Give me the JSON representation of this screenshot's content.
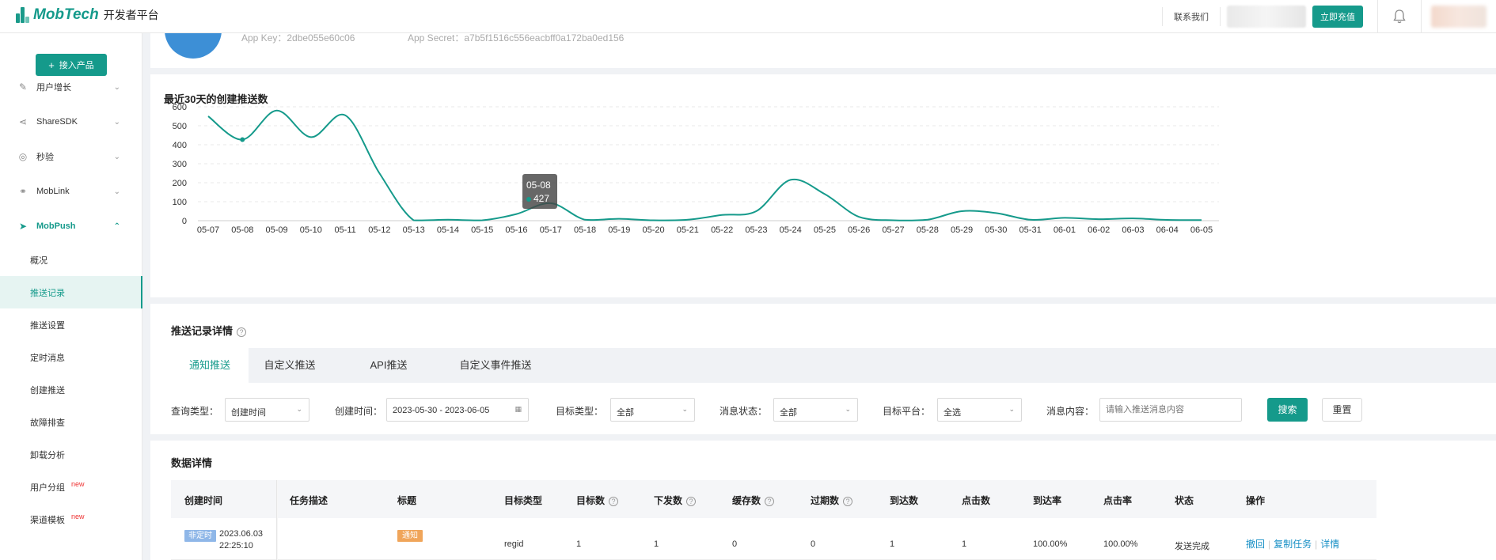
{
  "header": {
    "brand": "MobTech",
    "subtitle": "开发者平台",
    "contact": "联系我们",
    "recharge": "立即充值"
  },
  "sidebar": {
    "add_button": "接入产品",
    "groups": [
      {
        "label": "用户增长",
        "icon": "growth-icon"
      },
      {
        "label": "ShareSDK",
        "icon": "share-icon"
      },
      {
        "label": "秒验",
        "icon": "verify-icon"
      },
      {
        "label": "MobLink",
        "icon": "link-icon"
      },
      {
        "label": "MobPush",
        "icon": "send-icon"
      }
    ],
    "subitems": [
      {
        "label": "概况"
      },
      {
        "label": "推送记录",
        "active": true
      },
      {
        "label": "推送设置"
      },
      {
        "label": "定时消息"
      },
      {
        "label": "创建推送"
      },
      {
        "label": "故障排查"
      },
      {
        "label": "卸载分析"
      },
      {
        "label": "用户分组",
        "badge": "new"
      },
      {
        "label": "渠道模板",
        "badge": "new"
      }
    ]
  },
  "app_card": {
    "key_label": "App Key：2dbe055e60c06",
    "secret_label": "App Secret：a7b5f1516c556eacbff0a172ba0ed156"
  },
  "chart_data": {
    "type": "line",
    "title": "最近30天的创建推送数",
    "ylim": [
      0,
      600
    ],
    "yticks": [
      0,
      100,
      200,
      300,
      400,
      500,
      600
    ],
    "x": [
      "05-07",
      "05-08",
      "05-09",
      "05-10",
      "05-11",
      "05-12",
      "05-13",
      "05-14",
      "05-15",
      "05-16",
      "05-17",
      "05-18",
      "05-19",
      "05-20",
      "05-21",
      "05-22",
      "05-23",
      "05-24",
      "05-25",
      "05-26",
      "05-27",
      "05-28",
      "05-29",
      "05-30",
      "05-31",
      "06-01",
      "06-02",
      "06-03",
      "06-04",
      "06-05"
    ],
    "values": [
      550,
      427,
      580,
      440,
      555,
      250,
      2,
      5,
      2,
      35,
      92,
      5,
      10,
      2,
      5,
      30,
      50,
      215,
      140,
      20,
      2,
      5,
      50,
      40,
      5,
      15,
      8,
      12,
      4,
      3
    ],
    "grid": true,
    "tooltip": {
      "x": "05-08",
      "value": 427
    },
    "color": "#159a8b"
  },
  "records": {
    "title": "推送记录详情",
    "tabs": [
      "通知推送",
      "自定义推送",
      "API推送",
      "自定义事件推送"
    ],
    "filters": {
      "query_type_label": "查询类型：",
      "query_type_value": "创建时间",
      "created_label": "创建时间：",
      "created_value": "2023-05-30 - 2023-06-05",
      "target_type_label": "目标类型：",
      "target_type_value": "全部",
      "msg_status_label": "消息状态：",
      "msg_status_value": "全部",
      "platform_label": "目标平台：",
      "platform_value": "全选",
      "content_label": "消息内容：",
      "content_placeholder": "请输入推送消息内容",
      "search": "搜索",
      "reset": "重置"
    }
  },
  "details": {
    "title": "数据详情",
    "columns": [
      "创建时间",
      "任务描述",
      "标题",
      "目标类型",
      "目标数",
      "下发数",
      "缓存数",
      "过期数",
      "到达数",
      "点击数",
      "到达率",
      "点击率",
      "状态",
      "操作"
    ],
    "row": {
      "tag": "非定时",
      "date": "2023.06.03",
      "time": "22:25:10",
      "title_tag": "通知",
      "target_type": "regid",
      "target": "1",
      "sent": "1",
      "cached": "0",
      "expired": "0",
      "arrived": "1",
      "clicked": "1",
      "arrive_rate": "100.00%",
      "click_rate": "100.00%",
      "status": "发送完成",
      "actions": [
        "撤回",
        "复制任务",
        "详情"
      ]
    }
  }
}
